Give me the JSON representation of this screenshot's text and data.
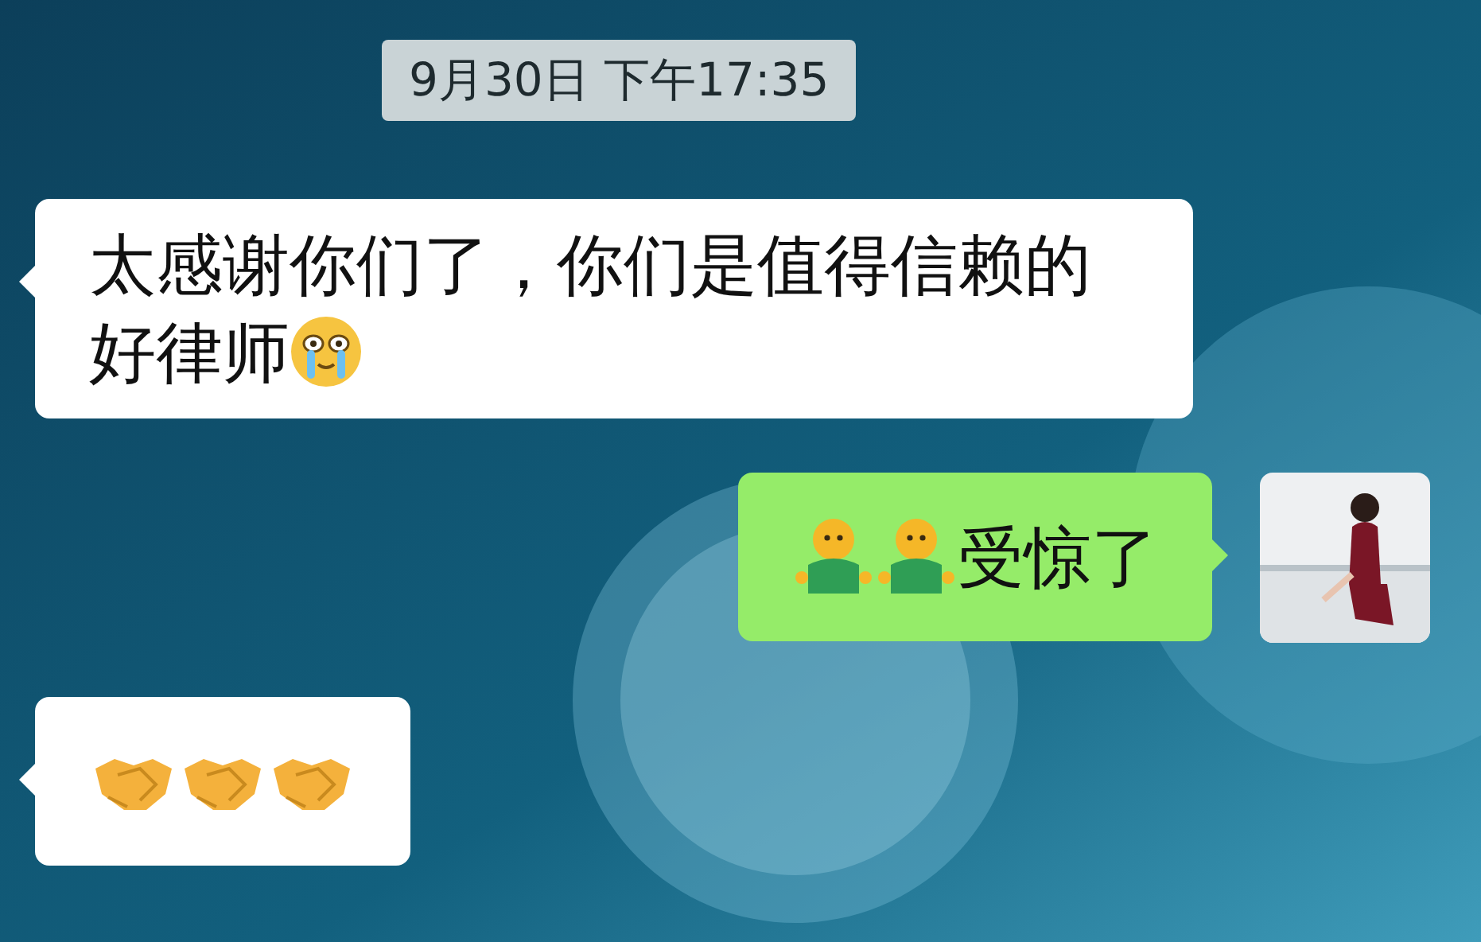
{
  "timestamp": "9月30日 下午17:35",
  "messages": [
    {
      "outgoing": false,
      "kind": "text",
      "text": "太感谢你们了，你们是值得信赖的好律师"
    },
    {
      "outgoing": true,
      "kind": "figures",
      "text": "受惊了"
    },
    {
      "outgoing": false,
      "kind": "handshakes"
    }
  ]
}
